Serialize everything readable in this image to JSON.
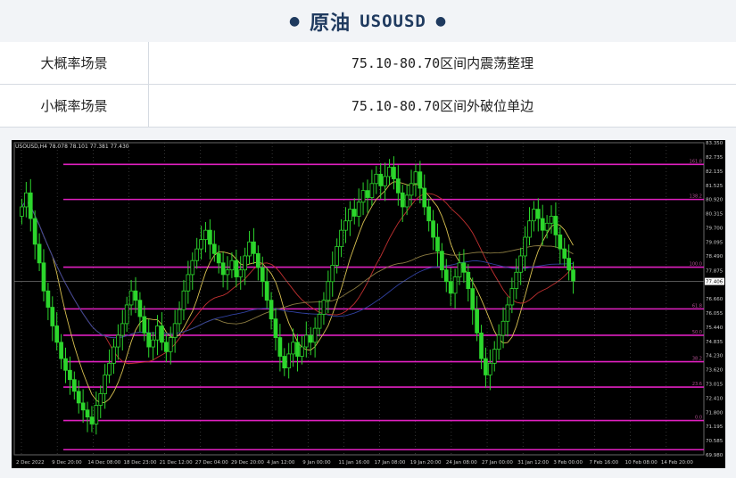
{
  "header": {
    "title_cn": "原油",
    "title_symbol": "USOUSD"
  },
  "scenarios": [
    {
      "label": "大概率场景",
      "value": "75.10-80.70区间内震荡整理"
    },
    {
      "label": "小概率场景",
      "value": "75.10-80.70区间外破位单边"
    }
  ],
  "chart_data": {
    "type": "candlestick",
    "symbol_info": "USOUSD,H4  78.078 78.101 77.381 77.430",
    "current_price": "77.406",
    "ylim": [
      69.98,
      83.35
    ],
    "price_labels": [
      "83.350",
      "82.735",
      "82.135",
      "81.525",
      "80.920",
      "80.315",
      "79.700",
      "79.095",
      "78.490",
      "77.875",
      "77.406",
      "76.660",
      "76.055",
      "75.440",
      "74.835",
      "74.230",
      "73.620",
      "73.015",
      "72.410",
      "71.800",
      "71.195",
      "70.585",
      "69.980"
    ],
    "x_labels": [
      "2 Dec 2022",
      "9 Dec 20:00",
      "14 Dec 08:00",
      "18 Dec 23:00",
      "21 Dec 12:00",
      "27 Dec 04:00",
      "29 Dec 20:00",
      "4 Jan 12:00",
      "9 Jan 00:00",
      "11 Jan 16:00",
      "17 Jan 08:00",
      "19 Jan 20:00",
      "24 Jan 08:00",
      "27 Jan 00:00",
      "31 Jan 12:00",
      "3 Feb 00:00",
      "7 Feb 16:00",
      "10 Feb 08:00",
      "14 Feb 20:00"
    ],
    "fib_levels": [
      {
        "label": "161.8",
        "price": 82.42
      },
      {
        "label": "138.2",
        "price": 80.92
      },
      {
        "label": "100.0",
        "price": 78.02
      },
      {
        "label": "61.8",
        "price": 76.23
      },
      {
        "label": "50.0",
        "price": 75.1
      },
      {
        "label": "38.2",
        "price": 73.97
      },
      {
        "label": "23.6",
        "price": 72.88
      },
      {
        "label": "0.0",
        "price": 71.45
      },
      {
        "label": "",
        "price": 70.2
      }
    ],
    "closes": [
      80.6,
      81.2,
      80.1,
      79.0,
      78.2,
      77.0,
      76.3,
      75.5,
      74.8,
      74.1,
      73.6,
      73.2,
      72.7,
      72.2,
      71.9,
      71.6,
      71.3,
      72.1,
      72.6,
      73.4,
      73.9,
      74.6,
      75.1,
      75.6,
      76.4,
      77.0,
      76.6,
      75.9,
      75.2,
      74.6,
      74.9,
      75.5,
      74.8,
      74.4,
      75.0,
      75.6,
      76.2,
      77.0,
      77.7,
      78.3,
      78.8,
      79.2,
      79.6,
      79.0,
      78.6,
      78.2,
      77.7,
      77.9,
      78.3,
      77.6,
      77.9,
      78.5,
      79.1,
      78.6,
      78.0,
      77.4,
      76.6,
      75.8,
      75.0,
      74.2,
      73.7,
      74.3,
      74.8,
      74.2,
      74.6,
      75.1,
      74.8,
      75.4,
      76.0,
      76.6,
      77.4,
      78.1,
      78.9,
      79.6,
      80.0,
      80.5,
      80.2,
      80.8,
      81.3,
      81.0,
      81.6,
      82.0,
      81.5,
      81.9,
      82.3,
      81.8,
      81.2,
      80.6,
      81.1,
      81.6,
      82.1,
      81.4,
      80.6,
      80.0,
      79.3,
      78.7,
      77.9,
      77.4,
      76.9,
      77.6,
      78.2,
      77.8,
      77.1,
      76.2,
      75.2,
      74.1,
      73.4,
      73.9,
      74.5,
      75.1,
      75.7,
      76.4,
      77.1,
      77.8,
      78.5,
      79.3,
      80.0,
      80.5,
      80.1,
      79.6,
      79.9,
      80.2,
      79.4,
      78.8,
      78.4,
      77.9,
      77.43
    ]
  }
}
